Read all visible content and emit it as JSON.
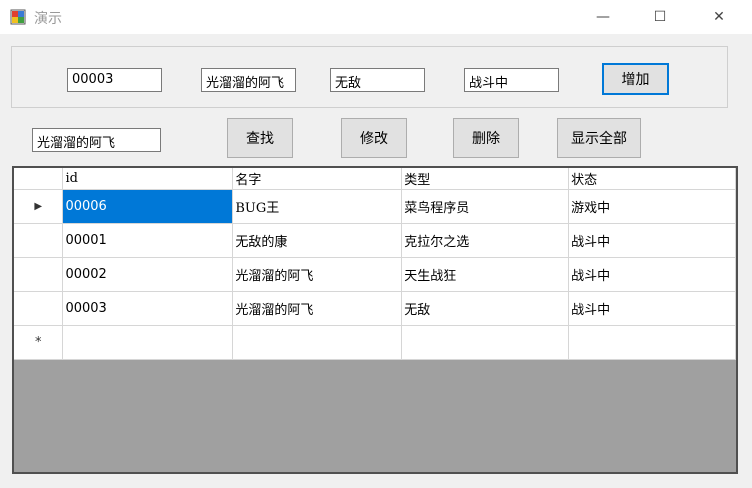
{
  "window": {
    "title": "演示",
    "minimize": "—",
    "maximize": "☐",
    "close": "✕"
  },
  "form": {
    "id_value": "00003",
    "name_value": "光溜溜的阿飞",
    "type_value": "无敌",
    "status_value": "战斗中",
    "add_label": "增加",
    "search_value": "光溜溜的阿飞",
    "find_label": "查找",
    "edit_label": "修改",
    "delete_label": "删除",
    "show_all_label": "显示全部"
  },
  "grid": {
    "columns": [
      "id",
      "名字",
      "类型",
      "状态"
    ],
    "current_row_marker": "▶",
    "new_row_marker": "*",
    "rows": [
      {
        "id": "00006",
        "name": "BUG王",
        "type": "菜鸟程序员",
        "status": "游戏中"
      },
      {
        "id": "00001",
        "name": "无敌的康",
        "type": "克拉尔之选",
        "status": "战斗中"
      },
      {
        "id": "00002",
        "name": "光溜溜的阿飞",
        "type": "天生战狂",
        "status": "战斗中"
      },
      {
        "id": "00003",
        "name": "光溜溜的阿飞",
        "type": "无敌",
        "status": "战斗中"
      }
    ]
  }
}
